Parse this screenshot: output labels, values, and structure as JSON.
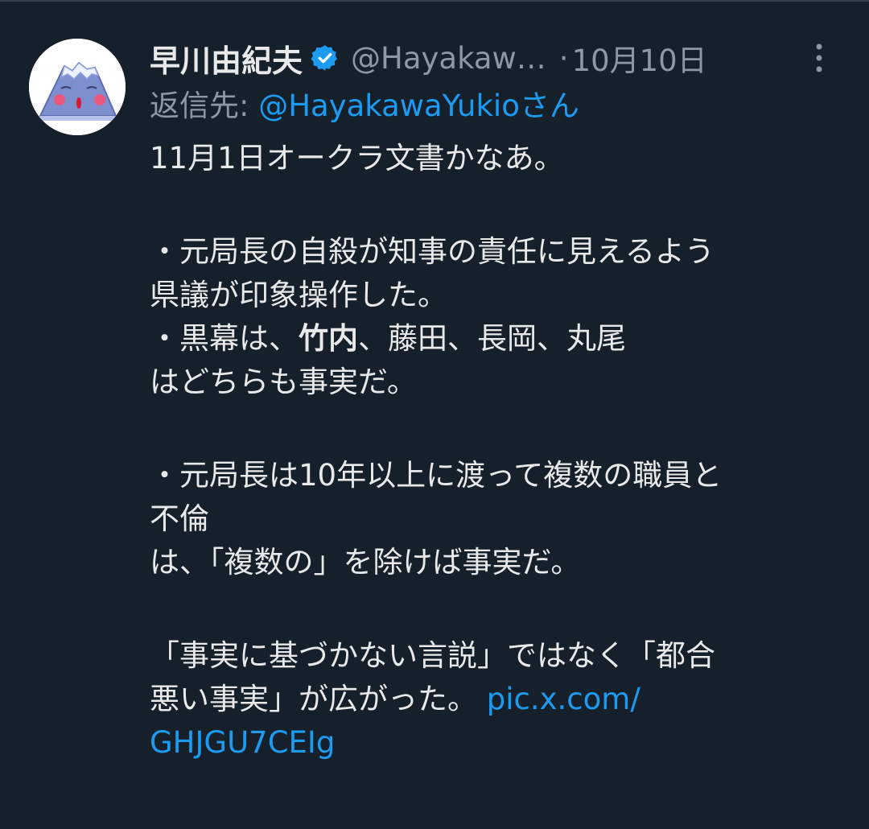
{
  "tweet": {
    "display_name": "早川由紀夫",
    "handle": "@Hayakaw…",
    "date": "10月10日",
    "separator": "·",
    "verified": true,
    "reply_prefix": "返信先: ",
    "reply_handle": "@HayakawaYukio",
    "reply_suffix": "さん",
    "lines": {
      "l1": "11月1日オークラ文書かなあ。",
      "l2": "・元局長の自殺が知事の責任に見えるよう",
      "l3": "県議が印象操作した。",
      "l4a": "・黒幕は、",
      "l4b": "竹内",
      "l4c": "、藤田、長岡、丸尾",
      "l5": "はどちらも事実だ。",
      "l6": "・元局長は10年以上に渡って複数の職員と",
      "l7": "不倫",
      "l8": "は、「複数の」を除けば事実だ。",
      "l9": "「事実に基づかない言説」ではなく「都合",
      "l10": "悪い事実」が広がった。 ",
      "l10_link": "pic.x.com/",
      "l11_link": "GHJGU7CEIg"
    }
  },
  "colors": {
    "background": "#15202b",
    "text": "#e7e9ea",
    "secondary": "#8b98a5",
    "link": "#1d9bf0",
    "verified": "#1d9bf0"
  },
  "icons": {
    "avatar": "mount-fuji-face-avatar",
    "verified": "verified-badge-icon",
    "more": "vertical-ellipsis-icon"
  }
}
